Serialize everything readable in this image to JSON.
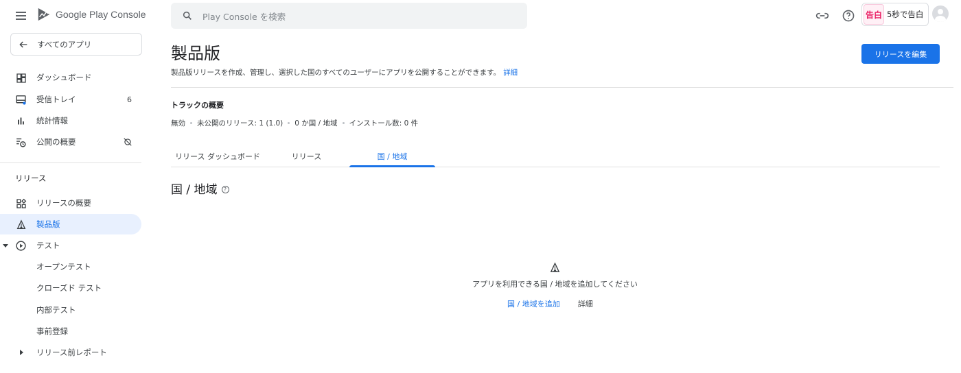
{
  "header": {
    "logo_text_google": "Google Play",
    "logo_text_console": "Console",
    "search_placeholder": "Play Console を検索",
    "app_name": "5秒で告白",
    "app_thumb_text": "告白"
  },
  "sidebar": {
    "back_label": "すべてのアプリ",
    "items": [
      {
        "label": "ダッシュボード"
      },
      {
        "label": "受信トレイ",
        "count": "6"
      },
      {
        "label": "統計情報"
      },
      {
        "label": "公開の概要"
      }
    ],
    "release_section": "リリース",
    "release_items": [
      {
        "label": "リリースの概要"
      },
      {
        "label": "製品版"
      },
      {
        "label": "テスト"
      },
      {
        "label": "オープンテスト"
      },
      {
        "label": "クローズド テスト"
      },
      {
        "label": "内部テスト"
      },
      {
        "label": "事前登録"
      },
      {
        "label": "リリース前レポート"
      }
    ]
  },
  "main": {
    "title": "製品版",
    "description": "製品版リリースを作成、管理し、選択した国のすべてのユーザーにアプリを公開することができます。",
    "description_link": "詳細",
    "edit_button": "リリースを編集",
    "track_title": "トラックの概要",
    "track_meta": [
      "無効",
      "未公開のリリース: 1 (1.0)",
      "0 か国 / 地域",
      "インストール数: 0 件"
    ],
    "tabs": [
      {
        "label": "リリース ダッシュボード"
      },
      {
        "label": "リリース"
      },
      {
        "label": "国 / 地域",
        "active": true
      }
    ],
    "section_title": "国 / 地域",
    "empty_message": "アプリを利用できる国 / 地域を追加してください",
    "empty_add_link": "国 / 地域を追加",
    "empty_details_link": "詳細"
  },
  "colors": {
    "accent": "#1a73e8",
    "active_nav_bg": "#e8f0fe"
  }
}
